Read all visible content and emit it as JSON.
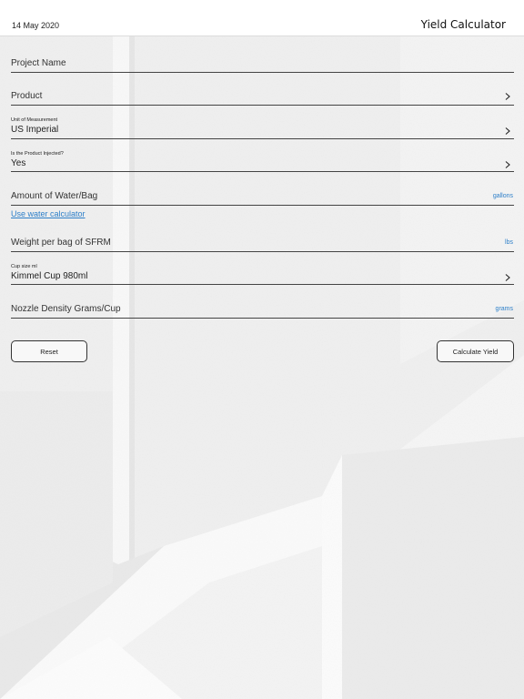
{
  "header": {
    "date": "14 May 2020",
    "title": "Yield Calculator"
  },
  "form": {
    "project_name": {
      "placeholder": "Project Name"
    },
    "product": {
      "placeholder": "Product"
    },
    "unit_of_measurement": {
      "label": "Unit of Measurement",
      "value": "US Imperial"
    },
    "product_injected": {
      "label": "Is the Product Injected?",
      "value": "Yes"
    },
    "water_per_bag": {
      "placeholder": "Amount of Water/Bag",
      "unit": "gallons"
    },
    "water_calculator_link": "Use water calculator",
    "weight_per_bag": {
      "placeholder": "Weight per bag of SFRM",
      "unit": "lbs"
    },
    "cup_size": {
      "label": "Cup size ml",
      "value": "Kimmel Cup 980ml"
    },
    "nozzle_density": {
      "placeholder": "Nozzle Density Grams/Cup",
      "unit": "grams"
    }
  },
  "buttons": {
    "reset": "Reset",
    "calculate": "Calculate Yield"
  },
  "colors": {
    "accent": "#2d7fc9",
    "background": "#f1f1f1"
  }
}
